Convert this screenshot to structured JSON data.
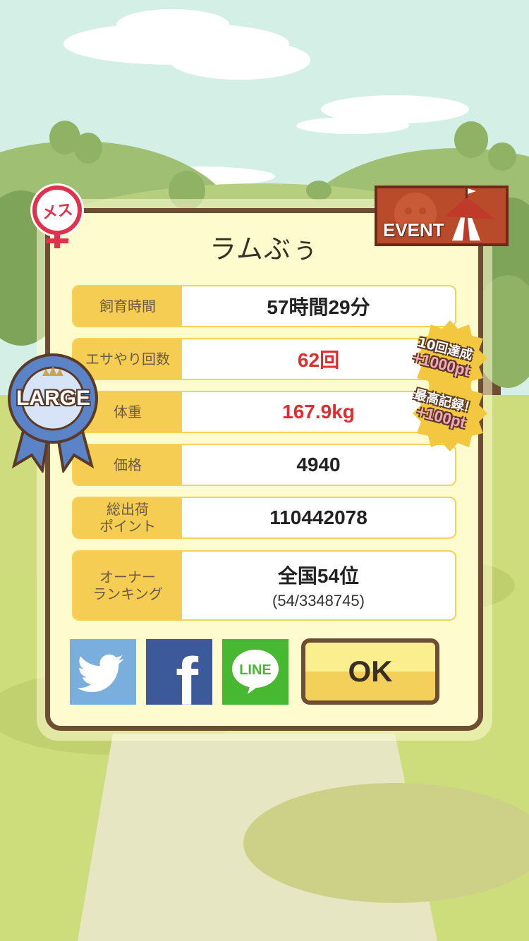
{
  "pet": {
    "name": "ラムぶぅ",
    "gender_badge": "メス",
    "size_ribbon": "LARGE"
  },
  "event_badge": {
    "label": "EVENT"
  },
  "stats": [
    {
      "label": "飼育時間",
      "value": "57時間29分"
    },
    {
      "label": "エサやり回数",
      "value": "62回"
    },
    {
      "label": "体重",
      "value": "167.9kg"
    },
    {
      "label": "価格",
      "value": "4940"
    },
    {
      "label": "総出荷\nポイント",
      "value": "110442078"
    },
    {
      "label": "オーナー\nランキング",
      "value": "全国54位",
      "sub": "(54/3348745)"
    }
  ],
  "bonuses": [
    {
      "title": "10回達成",
      "points": "+1000pt"
    },
    {
      "title": "最高記録！",
      "points": "+100pt"
    }
  ],
  "share": {
    "twitter": "twitter",
    "facebook": "f",
    "line": "LINE"
  },
  "ok_label": "OK",
  "colors": {
    "panel_bg": "#fefccf",
    "panel_border": "#6e4e32",
    "label_bg": "#f4cd52",
    "highlight_value": "#e02d2d",
    "twitter": "#7aaedc",
    "facebook": "#3c5a99",
    "line": "#48b833"
  }
}
